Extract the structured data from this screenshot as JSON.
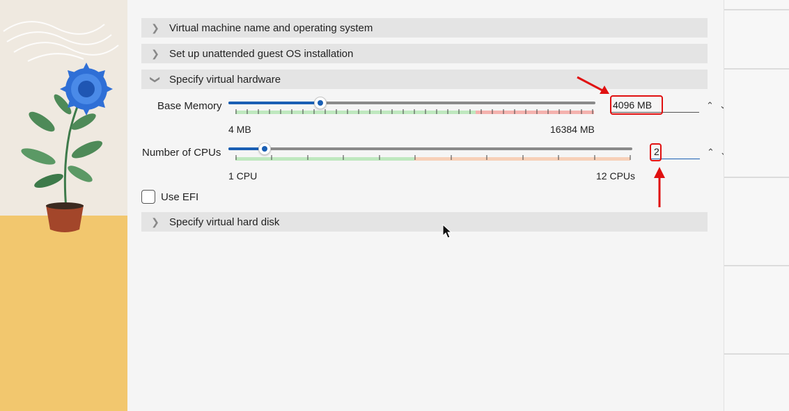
{
  "sections": [
    {
      "label": "Virtual machine name and operating system",
      "expanded": false
    },
    {
      "label": "Set up unattended guest OS installation",
      "expanded": false
    },
    {
      "label": "Specify virtual hardware",
      "expanded": true
    },
    {
      "label": "Specify virtual hard disk",
      "expanded": false
    }
  ],
  "hardware": {
    "memory": {
      "label": "Base Memory",
      "value": "4096 MB",
      "min_label": "4 MB",
      "max_label": "16384 MB",
      "fraction": 0.25
    },
    "cpus": {
      "label": "Number of CPUs",
      "value": "2",
      "min_label": "1 CPU",
      "max_label": "12 CPUs",
      "fraction": 0.09
    },
    "efi_label": "Use EFI",
    "efi_checked": false
  },
  "colors": {
    "accent": "#1a5fb4",
    "band_green": "#bfe8bf",
    "band_orange": "#f7d0b8",
    "band_red": "#f4b2ae",
    "highlight": "#e01010"
  }
}
